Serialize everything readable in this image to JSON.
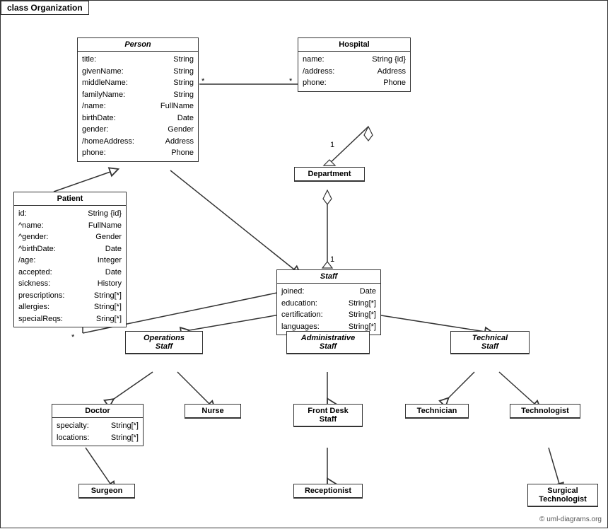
{
  "diagram": {
    "title": "class Organization",
    "watermark": "© uml-diagrams.org",
    "classes": {
      "Person": {
        "title": "Person",
        "italic": true,
        "attrs": [
          {
            "name": "title:",
            "type": "String"
          },
          {
            "name": "givenName:",
            "type": "String"
          },
          {
            "name": "middleName:",
            "type": "String"
          },
          {
            "name": "familyName:",
            "type": "String"
          },
          {
            "name": "/name:",
            "type": "FullName"
          },
          {
            "name": "birthDate:",
            "type": "Date"
          },
          {
            "name": "gender:",
            "type": "Gender"
          },
          {
            "name": "/homeAddress:",
            "type": "Address"
          },
          {
            "name": "phone:",
            "type": "Phone"
          }
        ]
      },
      "Hospital": {
        "title": "Hospital",
        "italic": false,
        "attrs": [
          {
            "name": "name:",
            "type": "String {id}"
          },
          {
            "name": "/address:",
            "type": "Address"
          },
          {
            "name": "phone:",
            "type": "Phone"
          }
        ]
      },
      "Patient": {
        "title": "Patient",
        "italic": false,
        "attrs": [
          {
            "name": "id:",
            "type": "String {id}"
          },
          {
            "name": "^name:",
            "type": "FullName"
          },
          {
            "name": "^gender:",
            "type": "Gender"
          },
          {
            "name": "^birthDate:",
            "type": "Date"
          },
          {
            "name": "/age:",
            "type": "Integer"
          },
          {
            "name": "accepted:",
            "type": "Date"
          },
          {
            "name": "sickness:",
            "type": "History"
          },
          {
            "name": "prescriptions:",
            "type": "String[*]"
          },
          {
            "name": "allergies:",
            "type": "String[*]"
          },
          {
            "name": "specialReqs:",
            "type": "Sring[*]"
          }
        ]
      },
      "Department": {
        "title": "Department",
        "italic": false,
        "attrs": []
      },
      "Staff": {
        "title": "Staff",
        "italic": true,
        "attrs": [
          {
            "name": "joined:",
            "type": "Date"
          },
          {
            "name": "education:",
            "type": "String[*]"
          },
          {
            "name": "certification:",
            "type": "String[*]"
          },
          {
            "name": "languages:",
            "type": "String[*]"
          }
        ]
      },
      "OperationsStaff": {
        "title": "Operations\nStaff",
        "italic": true,
        "attrs": []
      },
      "AdministrativeStaff": {
        "title": "Administrative\nStaff",
        "italic": true,
        "attrs": []
      },
      "TechnicalStaff": {
        "title": "Technical\nStaff",
        "italic": true,
        "attrs": []
      },
      "Doctor": {
        "title": "Doctor",
        "italic": false,
        "attrs": [
          {
            "name": "specialty:",
            "type": "String[*]"
          },
          {
            "name": "locations:",
            "type": "String[*]"
          }
        ]
      },
      "Nurse": {
        "title": "Nurse",
        "italic": false,
        "attrs": []
      },
      "FrontDeskStaff": {
        "title": "Front Desk\nStaff",
        "italic": false,
        "attrs": []
      },
      "Technician": {
        "title": "Technician",
        "italic": false,
        "attrs": []
      },
      "Technologist": {
        "title": "Technologist",
        "italic": false,
        "attrs": []
      },
      "Surgeon": {
        "title": "Surgeon",
        "italic": false,
        "attrs": []
      },
      "Receptionist": {
        "title": "Receptionist",
        "italic": false,
        "attrs": []
      },
      "SurgicalTechnologist": {
        "title": "Surgical\nTechnologist",
        "italic": false,
        "attrs": []
      }
    }
  }
}
